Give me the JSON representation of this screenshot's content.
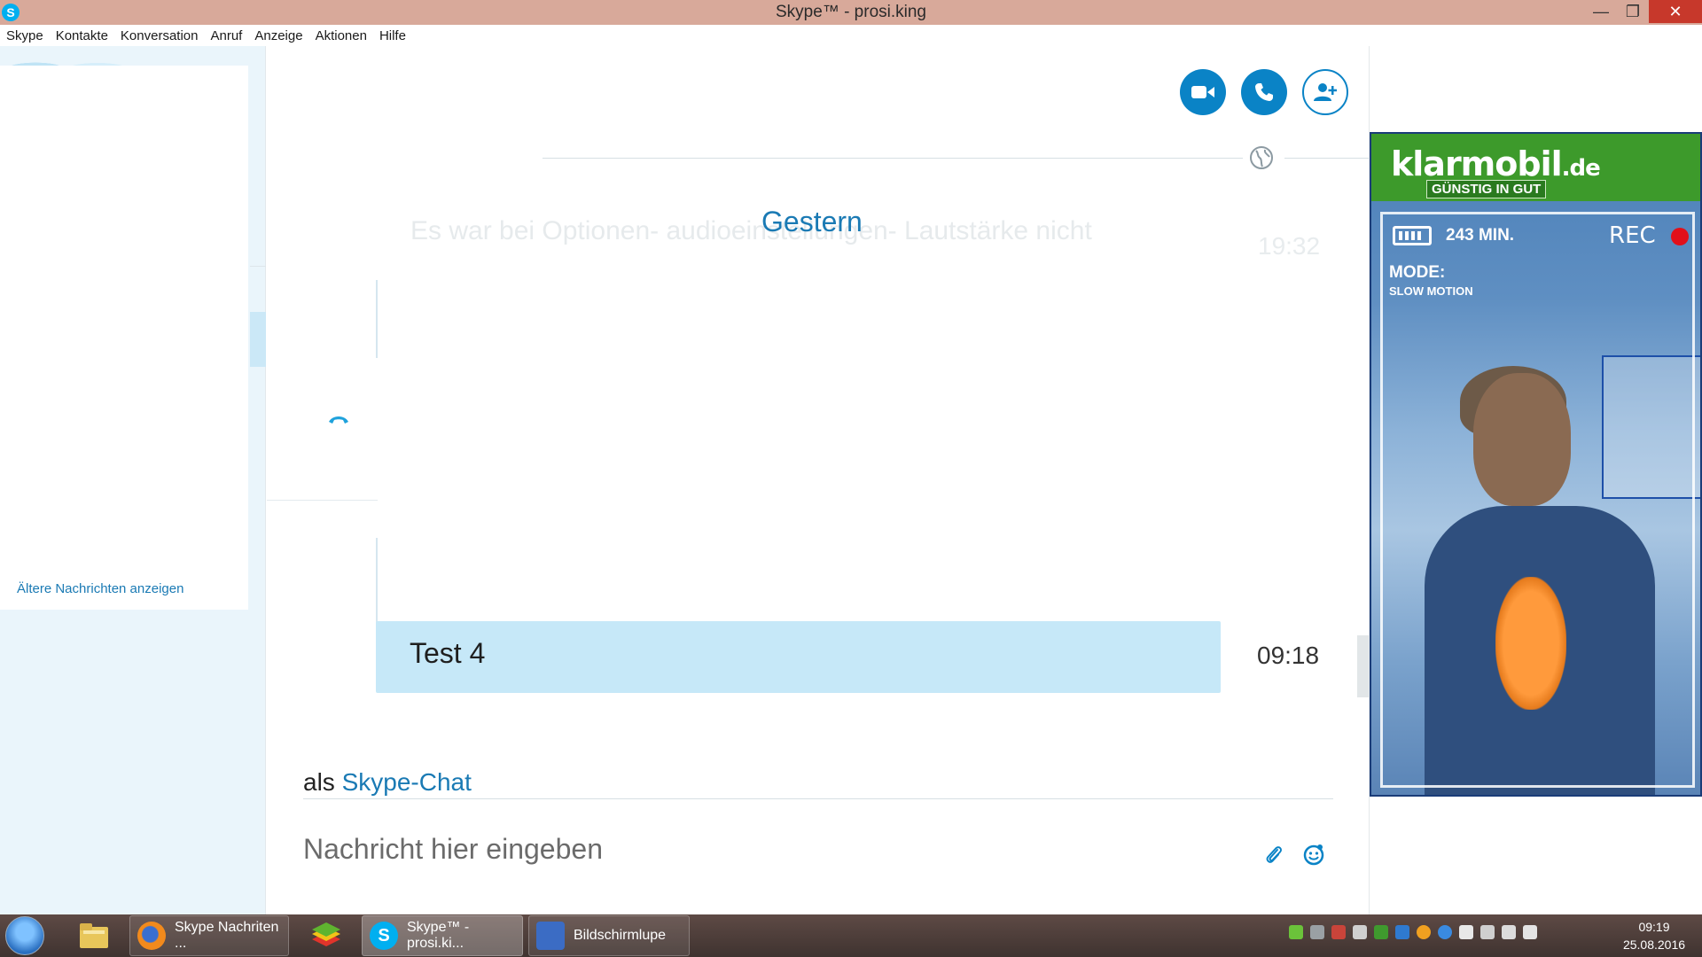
{
  "window": {
    "title": "Skype™ - prosi.king",
    "app_icon": "S",
    "minimize": "—",
    "maximize": "❐",
    "close": "✕"
  },
  "menu": [
    "Skype",
    "Kontakte",
    "Konversation",
    "Anruf",
    "Anzeige",
    "Aktionen",
    "Hilfe"
  ],
  "sidebar": {
    "older_messages_link": "Ältere Nachrichten anzeigen"
  },
  "conversation": {
    "toolbar_icons": [
      "video-call-icon",
      "call-icon",
      "add-contact-icon"
    ],
    "date_divider": "Gestern",
    "faded_message": "Es war bei Optionen- audioeinstellungen- Lautstärke nicht",
    "faded_time": "19:32",
    "last_message": {
      "text": "Test 4",
      "time": "09:18"
    },
    "mode_prefix": "als",
    "mode_link": "Skype-Chat",
    "input_placeholder": "Nachricht hier eingeben"
  },
  "ad": {
    "brand": "klarmobil",
    "brand_suffix": ".de",
    "tagline": "GÜNSTIG IN GUT",
    "minutes": "243 MIN.",
    "rec": "REC",
    "mode_label": "MODE:",
    "mode_value": "SLOW MOTION"
  },
  "taskbar": {
    "buttons": [
      {
        "label": "Skype Nachriten ...",
        "icon": "firefox-icon"
      },
      {
        "label": "Skype™ - prosi.ki...",
        "icon": "skype-icon"
      },
      {
        "label": "Bildschirmlupe",
        "icon": "magnifier-icon"
      }
    ],
    "clock_time": "09:19",
    "clock_date": "25.08.2016"
  },
  "colors": {
    "accent": "#0a83c6",
    "link": "#1a7ab4",
    "bubble": "#c6e8f8",
    "titlebar": "#d8a99a"
  }
}
